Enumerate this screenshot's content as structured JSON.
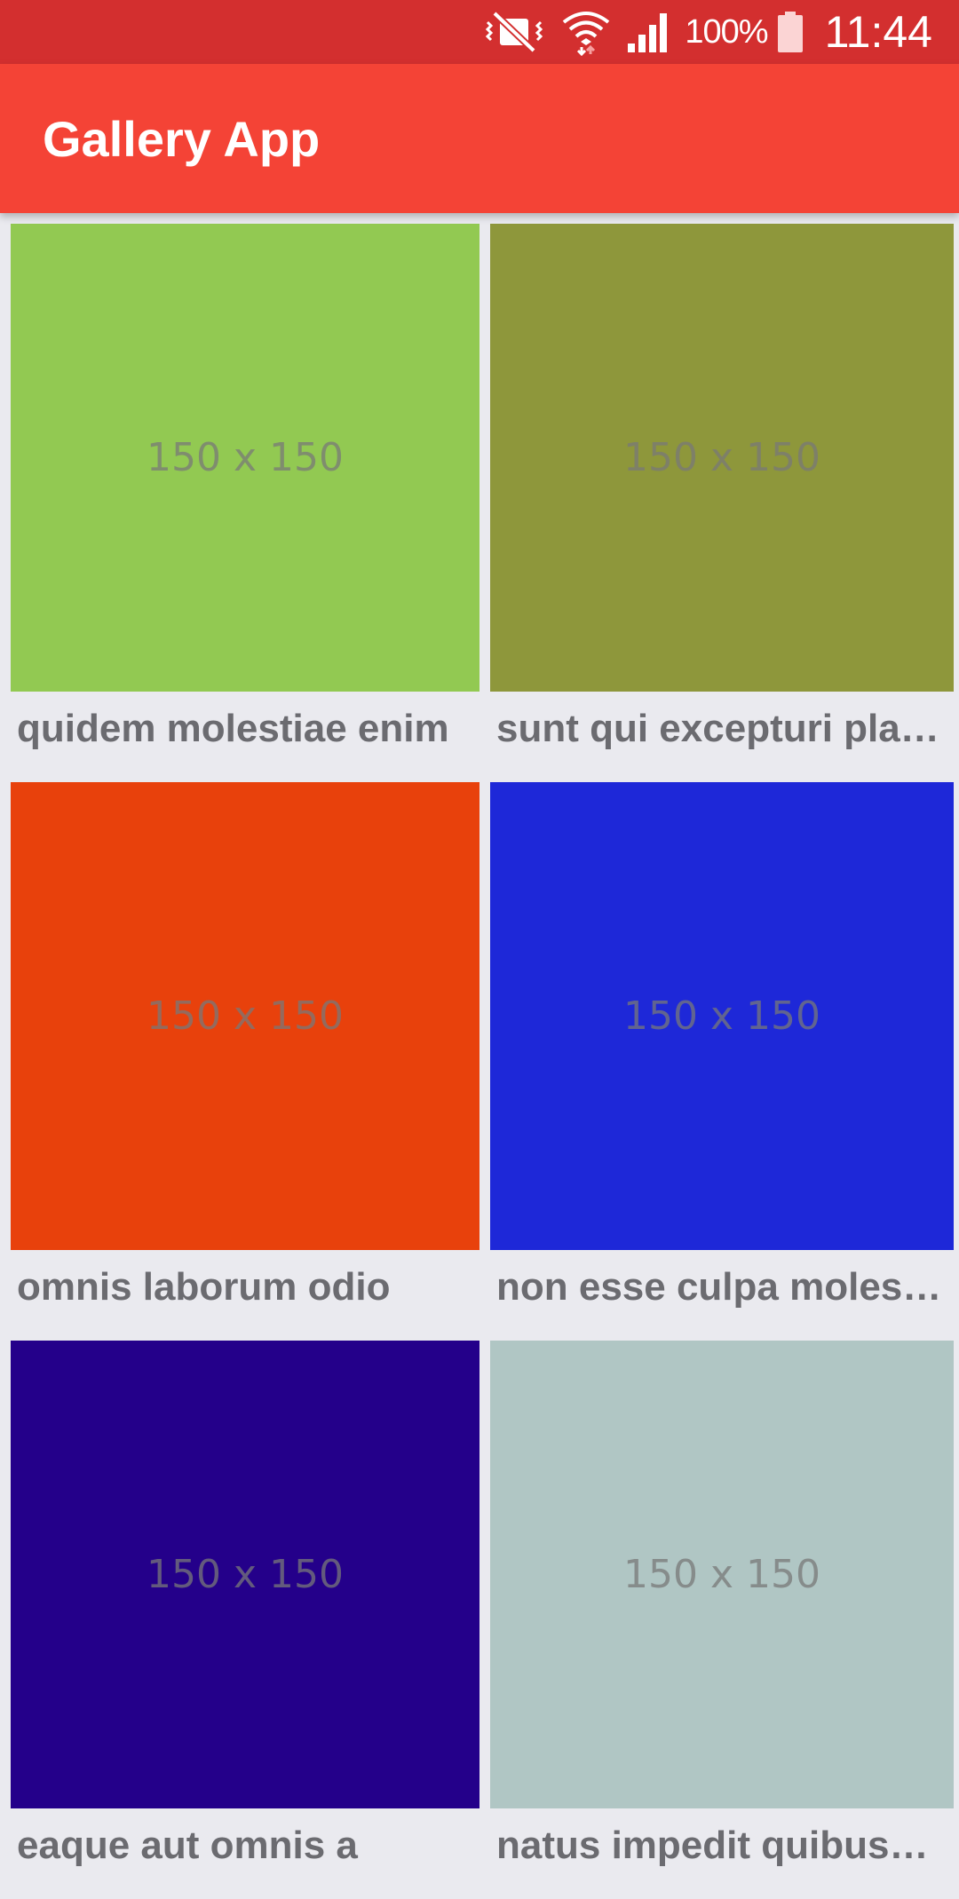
{
  "status_bar": {
    "icons": [
      "vibrate-mute-icon",
      "wifi-icon",
      "signal-icon",
      "battery-icon"
    ],
    "battery_percent": "100%",
    "time": "11:44"
  },
  "app_bar": {
    "title": "Gallery App",
    "color": "#F44336"
  },
  "gallery": {
    "items": [
      {
        "caption": "quidem molestiae enim",
        "thumb_text": "150 x 150",
        "color": "#92C952"
      },
      {
        "caption": "sunt qui excepturi placeat culpa",
        "thumb_text": "150 x 150",
        "color": "#8E973B"
      },
      {
        "caption": "omnis laborum odio",
        "thumb_text": "150 x 150",
        "color": "#E8410C"
      },
      {
        "caption": "non esse culpa molestiae omnis sed optio",
        "thumb_text": "150 x 150",
        "color": "#1E28D8"
      },
      {
        "caption": "eaque aut omnis a",
        "thumb_text": "150 x 150",
        "color": "#24008A"
      },
      {
        "caption": "natus impedit quibusdam illo est",
        "thumb_text": "150 x 150",
        "color": "#B0C6C4"
      }
    ]
  }
}
